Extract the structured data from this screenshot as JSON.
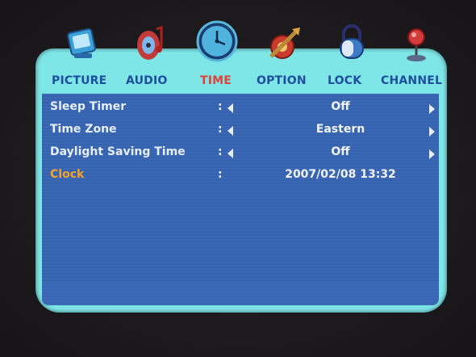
{
  "tabs": [
    {
      "label": "PICTURE",
      "icon": "picture-icon"
    },
    {
      "label": "AUDIO",
      "icon": "audio-icon"
    },
    {
      "label": "TIME",
      "icon": "clock-icon",
      "active": true
    },
    {
      "label": "OPTION",
      "icon": "option-icon"
    },
    {
      "label": "LOCK",
      "icon": "lock-icon"
    },
    {
      "label": "CHANNEL",
      "icon": "channel-icon"
    }
  ],
  "settings": [
    {
      "label": "Sleep Timer",
      "colon": ":",
      "value": "Off"
    },
    {
      "label": "Time Zone",
      "colon": ":",
      "value": "Eastern"
    },
    {
      "label": "Daylight Saving Time",
      "colon": ":",
      "value": "Off"
    },
    {
      "label": "Clock",
      "colon": ":",
      "value": "2007/02/08 13:32"
    }
  ],
  "colors": {
    "frame": "#7fe6e8",
    "panel": "#3c68b6",
    "tab_text": "#1d4f9c",
    "tab_active": "#e2403a",
    "highlight": "#f6a32a"
  }
}
